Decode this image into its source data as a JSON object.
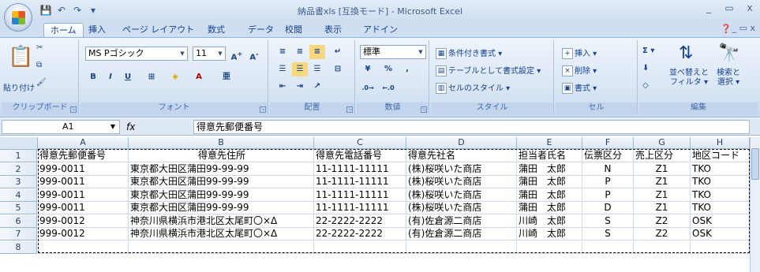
{
  "window": {
    "title": "納品書xls  [互換モード] - Microsoft Excel",
    "minimize": "_",
    "restore": "▭",
    "close": "x"
  },
  "qat": {
    "save": "💾",
    "undo": "↶",
    "redo": "↷",
    "more": "▾"
  },
  "tabs": [
    "ホーム",
    "挿入",
    "ページ レイアウト",
    "数式",
    "データ",
    "校閲",
    "表示",
    "アドイン"
  ],
  "ribbon": {
    "clipboard": {
      "paste": "貼り付け",
      "label": "クリップボード"
    },
    "font": {
      "name": "MS Pゴシック",
      "size": "11",
      "label": "フォント",
      "bold": "B",
      "italic": "I",
      "underline": "U"
    },
    "alignment": {
      "label": "配置"
    },
    "number": {
      "format": "標準",
      "percent": "%",
      "comma": ",",
      "label": "数値"
    },
    "styles": {
      "conditional": "条件付き書式 ▾",
      "table": "テーブルとして書式設定 ▾",
      "cell": "セルのスタイル ▾",
      "label": "スタイル"
    },
    "cells": {
      "insert": "挿入 ▾",
      "delete": "削除 ▾",
      "format": "書式 ▾",
      "label": "セル"
    },
    "editing": {
      "sum": "Σ ▾",
      "sort": "並べ替えと\nフィルタ ▾",
      "find": "検索と\n選択 ▾",
      "label": "編集"
    }
  },
  "namebox": "A1",
  "fx": "fx",
  "formula": "得意先郵便番号",
  "columns": [
    "A",
    "B",
    "C",
    "D",
    "E",
    "F",
    "G",
    "H"
  ],
  "rows": [
    [
      "得意先郵便番号",
      "得意先住所",
      "得意先電話番号",
      "得意先社名",
      "担当者氏名",
      "伝票区分",
      "売上区分",
      "地区コード"
    ],
    [
      "999-0011",
      "東京都大田区蒲田99-99-99",
      "11-1111-11111",
      "(株)桜咲いた商店",
      "蒲田　太郎",
      "N",
      "Z1",
      "TKO"
    ],
    [
      "999-0011",
      "東京都大田区蒲田99-99-99",
      "11-1111-11111",
      "(株)桜咲いた商店",
      "蒲田　太郎",
      "P",
      "Z1",
      "TKO"
    ],
    [
      "999-0011",
      "東京都大田区蒲田99-99-99",
      "11-1111-11111",
      "(株)桜咲いた商店",
      "蒲田　太郎",
      "P",
      "Z1",
      "TKO"
    ],
    [
      "999-0011",
      "東京都大田区蒲田99-99-99",
      "11-1111-11111",
      "(株)桜咲いた商店",
      "蒲田　太郎",
      "D",
      "Z1",
      "TKO"
    ],
    [
      "999-0012",
      "神奈川県横浜市港北区太尾町〇×Δ",
      "22-2222-2222",
      "(有)佐倉源二商店",
      "川崎　太郎",
      "S",
      "Z2",
      "OSK"
    ],
    [
      "999-0012",
      "神奈川県横浜市港北区太尾町〇×Δ",
      "22-2222-2222",
      "(有)佐倉源二商店",
      "川崎　太郎",
      "S",
      "Z2",
      "OSK"
    ],
    [
      "",
      "",
      "",
      "",
      "",
      "",
      "",
      ""
    ]
  ],
  "row_numbers": [
    "1",
    "2",
    "3",
    "4",
    "5",
    "6",
    "7",
    "8"
  ]
}
